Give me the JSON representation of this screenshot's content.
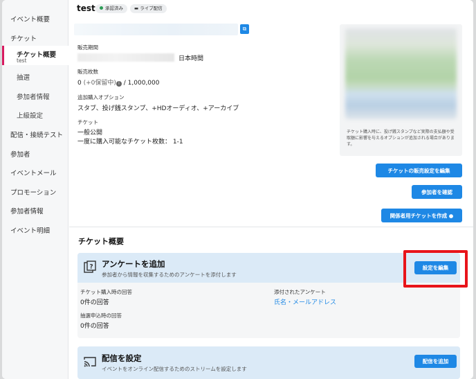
{
  "sidebar": {
    "items": [
      {
        "label": "イベント概要"
      },
      {
        "label": "チケット"
      },
      {
        "label": "チケット概要",
        "sub": "test"
      },
      {
        "label": "抽選"
      },
      {
        "label": "参加者情報"
      },
      {
        "label": "上級設定"
      },
      {
        "label": "配信・接続テスト"
      },
      {
        "label": "参加者"
      },
      {
        "label": "イベントメール"
      },
      {
        "label": "プロモーション"
      },
      {
        "label": "参加者情報"
      },
      {
        "label": "イベント明細"
      }
    ]
  },
  "header": {
    "title": "test",
    "badges": [
      "承認済み",
      "ライブ配信"
    ]
  },
  "details": {
    "period_label": "販売期間",
    "period_suffix": "日本時間",
    "count_label": "販売枚数",
    "count_value_prefix": "0",
    "count_hold": "(+0保留中)",
    "count_value_suffix": "/ 1,000,000",
    "options_label": "追加購入オプション",
    "options_value": "スタブ、投げ銭スタンプ、+HDオーディオ、+アーカイブ",
    "ticket_label": "チケット",
    "ticket_line1": "一般公開",
    "ticket_line2": "一度に購入可能なチケット枚数： 1-1"
  },
  "preview": {
    "note": "チケット購入時に、投げ銭スタンプなど実際の支払額や受取額に影響を与えるオプションが追加される場合があります。"
  },
  "actions": {
    "sales_settings": "チケットの販売設定を編集",
    "check_participants": "参加者を確認",
    "create_staff_ticket": "関係者用チケットを作成"
  },
  "overview": {
    "title": "チケット概要"
  },
  "survey": {
    "title": "アンケートを追加",
    "desc": "参加者から情報を収集するためのアンケートを添付します",
    "edit_button": "設定を編集",
    "purchase_label": "チケット購入時の回答",
    "purchase_value": "0件の回答",
    "attached_label": "添付されたアンケート",
    "attached_value": "氏名・メールアドレス",
    "lottery_label": "抽選申込時の回答",
    "lottery_value": "0件の回答"
  },
  "stream": {
    "title": "配信を設定",
    "desc": "イベントをオンライン配信するためのストリームを設定します",
    "add_button": "配信を追加"
  },
  "colors": {
    "accent": "#1e88e5",
    "active_marker": "#d81b60",
    "highlight": "#e8141a",
    "approved_dot": "#2e9d57"
  }
}
